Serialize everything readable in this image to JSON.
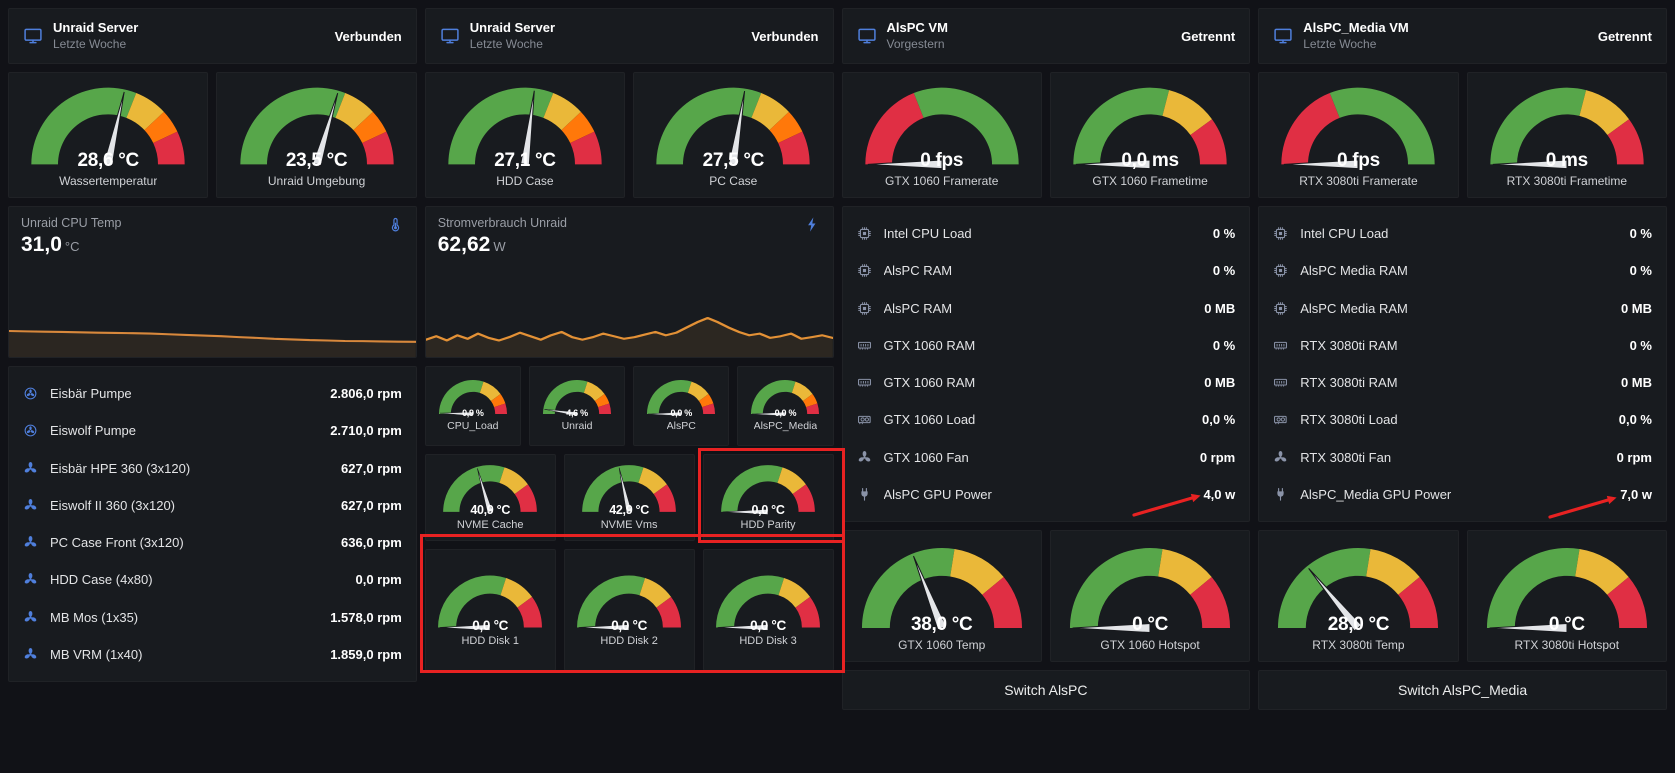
{
  "colors": {
    "green": "#57a64a",
    "yellow": "#eab839",
    "orange": "#ff780a",
    "red": "#e02f44",
    "needle": "#e3e5e8",
    "icon_blue": "#4f7fdc",
    "icon_muted": "#8a93a8",
    "annotation": "#e82222",
    "panel_bg": "#181b1f",
    "page_bg": "#111217"
  },
  "gauge_presets": {
    "temp": [
      [
        0,
        0.62,
        "green"
      ],
      [
        0.62,
        0.76,
        "yellow"
      ],
      [
        0.76,
        0.86,
        "orange"
      ],
      [
        0.86,
        1,
        "red"
      ]
    ],
    "fps": [
      [
        0,
        0.38,
        "red"
      ],
      [
        0.38,
        1,
        "green"
      ]
    ],
    "frametime": [
      [
        0,
        0.58,
        "green"
      ],
      [
        0.58,
        0.8,
        "yellow"
      ],
      [
        0.8,
        1,
        "red"
      ]
    ],
    "percent": [
      [
        0,
        0.6,
        "green"
      ],
      [
        0.6,
        0.8,
        "yellow"
      ],
      [
        0.8,
        0.9,
        "orange"
      ],
      [
        0.9,
        1,
        "red"
      ]
    ],
    "disk": [
      [
        0,
        0.6,
        "green"
      ],
      [
        0.6,
        0.8,
        "yellow"
      ],
      [
        0.8,
        1,
        "red"
      ]
    ],
    "gpu": [
      [
        0,
        0.55,
        "green"
      ],
      [
        0.55,
        0.78,
        "yellow"
      ],
      [
        0.78,
        1,
        "red"
      ]
    ]
  },
  "headers": [
    {
      "icon": "monitor-icon",
      "title": "Unraid Server",
      "subtitle": "Letzte Woche",
      "status": "Verbunden"
    },
    {
      "icon": "monitor-icon",
      "title": "Unraid Server",
      "subtitle": "Letzte Woche",
      "status": "Verbunden"
    },
    {
      "icon": "monitor-icon",
      "title": "AlsPC VM",
      "subtitle": "Vorgestern",
      "status": "Getrennt"
    },
    {
      "icon": "monitor-icon",
      "title": "AlsPC_Media VM",
      "subtitle": "Letzte Woche",
      "status": "Getrennt"
    }
  ],
  "gauges": {
    "wasser": {
      "value": "28,6 °C",
      "label": "Wassertemperatur",
      "pct": 0.57,
      "preset": "temp"
    },
    "umgebung": {
      "value": "23,5 °C",
      "label": "Unraid Umgebung",
      "pct": 0.59,
      "preset": "temp"
    },
    "hdd_case": {
      "value": "27,1 °C",
      "label": "HDD Case",
      "pct": 0.54,
      "preset": "temp"
    },
    "pc_case": {
      "value": "27,5 °C",
      "label": "PC Case",
      "pct": 0.55,
      "preset": "temp"
    },
    "gtx_fps": {
      "value": "0 fps",
      "label": "GTX 1060 Framerate",
      "pct": 0,
      "preset": "fps"
    },
    "gtx_ft": {
      "value": "0,0 ms",
      "label": "GTX 1060 Frametime",
      "pct": 0,
      "preset": "frametime"
    },
    "rtx_fps": {
      "value": "0 fps",
      "label": "RTX 3080ti Framerate",
      "pct": 0,
      "preset": "fps"
    },
    "rtx_ft": {
      "value": "0 ms",
      "label": "RTX 3080ti Frametime",
      "pct": 0,
      "preset": "frametime"
    },
    "cpu_load": {
      "value": "0,9 %",
      "label": "CPU_Load",
      "pct": 0.009,
      "preset": "percent"
    },
    "unraid": {
      "value": "4,6 %",
      "label": "Unraid",
      "pct": 0.046,
      "preset": "percent"
    },
    "alspc": {
      "value": "0,0 %",
      "label": "AlsPC",
      "pct": 0,
      "preset": "percent"
    },
    "alspc_media": {
      "value": "0,0 %",
      "label": "AlsPC_Media",
      "pct": 0,
      "preset": "percent"
    },
    "nvme_cache": {
      "value": "40,9 °C",
      "label": "NVME Cache",
      "pct": 0.41,
      "preset": "disk"
    },
    "nvme_vms": {
      "value": "42,9 °C",
      "label": "NVME Vms",
      "pct": 0.43,
      "preset": "disk"
    },
    "hdd_parity": {
      "value": "0,0 °C",
      "label": "HDD Parity",
      "pct": 0,
      "preset": "disk"
    },
    "hdd1": {
      "value": "0,0 °C",
      "label": "HDD Disk 1",
      "pct": 0,
      "preset": "disk"
    },
    "hdd2": {
      "value": "0,0 °C",
      "label": "HDD Disk 2",
      "pct": 0,
      "preset": "disk"
    },
    "hdd3": {
      "value": "0,0 °C",
      "label": "HDD Disk 3",
      "pct": 0,
      "preset": "disk"
    },
    "gtx_temp": {
      "value": "38,0 °C",
      "label": "GTX 1060 Temp",
      "pct": 0.38,
      "preset": "gpu"
    },
    "gtx_hot": {
      "value": "0 °C",
      "label": "GTX 1060 Hotspot",
      "pct": 0,
      "preset": "gpu"
    },
    "rtx_temp": {
      "value": "28,0 °C",
      "label": "RTX 3080ti Temp",
      "pct": 0.28,
      "preset": "gpu"
    },
    "rtx_hot": {
      "value": "0 °C",
      "label": "RTX 3080ti Hotspot",
      "pct": 0,
      "preset": "gpu"
    }
  },
  "charts": {
    "cpu": {
      "type": "line",
      "icon": "thermometer-icon",
      "title": "Unraid CPU Temp",
      "value": "31,0",
      "unit": "°C",
      "color": "#d8883c",
      "fill": "rgba(216,136,60,0.10)",
      "ylim": [
        26,
        38
      ],
      "values": [
        32.0,
        31.9,
        31.85,
        31.8,
        31.7,
        31.6,
        31.55,
        31.5,
        31.4,
        31.25,
        31.1,
        30.95,
        30.8,
        30.6,
        30.4,
        30.2,
        30.05,
        29.9,
        29.8,
        29.7,
        29.65,
        29.6,
        29.55,
        29.5
      ]
    },
    "strom": {
      "type": "line",
      "icon": "bolt-icon",
      "title": "Stromverbrauch Unraid",
      "value": "62,62",
      "unit": "W",
      "color": "#e39136",
      "fill": "rgba(227,145,54,0.10)",
      "ylim": [
        52,
        82
      ],
      "values": [
        62,
        64,
        61.5,
        64.5,
        62.5,
        65.5,
        63,
        61.5,
        63.5,
        66,
        64,
        62,
        64.5,
        66.5,
        63.5,
        62,
        63.5,
        65.5,
        64,
        62.5,
        63.5,
        65,
        66.5,
        64.5,
        66,
        69,
        72,
        74.5,
        72,
        69,
        66.5,
        64.5,
        65.5,
        63,
        64,
        65.5,
        62.5,
        63.5,
        64.5,
        63
      ]
    }
  },
  "fan_list": {
    "rows": [
      {
        "icon": "pump-icon",
        "label": "Eisbär Pumpe",
        "value": "2.806,0 rpm"
      },
      {
        "icon": "pump-icon",
        "label": "Eiswolf Pumpe",
        "value": "2.710,0 rpm"
      },
      {
        "icon": "fan-icon",
        "label": "Eisbär HPE 360 (3x120)",
        "value": "627,0 rpm"
      },
      {
        "icon": "fan-icon",
        "label": "Eiswolf II 360 (3x120)",
        "value": "627,0 rpm"
      },
      {
        "icon": "fan-icon",
        "label": "PC Case Front (3x120)",
        "value": "636,0 rpm"
      },
      {
        "icon": "fan-icon",
        "label": "HDD Case (4x80)",
        "value": "0,0 rpm"
      },
      {
        "icon": "fan-icon",
        "label": "MB Mos (1x35)",
        "value": "1.578,0 rpm"
      },
      {
        "icon": "fan-icon",
        "label": "MB VRM (1x40)",
        "value": "1.859,0 rpm"
      }
    ]
  },
  "stats_alspc": {
    "rows": [
      {
        "icon": "cpu-icon",
        "label": "Intel CPU Load",
        "value": "0 %"
      },
      {
        "icon": "ram-icon",
        "label": "AlsPC RAM",
        "value": "0 %"
      },
      {
        "icon": "ram-icon",
        "label": "AlsPC RAM",
        "value": "0 MB"
      },
      {
        "icon": "gpu-ram-icon",
        "label": "GTX 1060 RAM",
        "value": "0 %"
      },
      {
        "icon": "gpu-ram-icon",
        "label": "GTX 1060 RAM",
        "value": "0 MB"
      },
      {
        "icon": "gpu-icon",
        "label": "GTX 1060 Load",
        "value": "0,0 %"
      },
      {
        "icon": "fan-icon",
        "label": "GTX 1060 Fan",
        "value": "0 rpm"
      },
      {
        "icon": "power-icon",
        "label": "AlsPC GPU Power",
        "value": "4,0 w"
      }
    ]
  },
  "stats_media": {
    "rows": [
      {
        "icon": "cpu-icon",
        "label": "Intel CPU Load",
        "value": "0 %"
      },
      {
        "icon": "ram-icon",
        "label": "AlsPC Media RAM",
        "value": "0 %"
      },
      {
        "icon": "ram-icon",
        "label": "AlsPC Media RAM",
        "value": "0 MB"
      },
      {
        "icon": "gpu-ram-icon",
        "label": "RTX 3080ti RAM",
        "value": "0 %"
      },
      {
        "icon": "gpu-ram-icon",
        "label": "RTX 3080ti RAM",
        "value": "0 MB"
      },
      {
        "icon": "gpu-icon",
        "label": "RTX 3080ti Load",
        "value": "0,0 %"
      },
      {
        "icon": "fan-icon",
        "label": "RTX 3080ti Fan",
        "value": "0 rpm"
      },
      {
        "icon": "power-icon",
        "label": "AlsPC_Media GPU Power",
        "value": "7,0 w"
      }
    ]
  },
  "buttons": {
    "switch_alspc": "Switch AlsPC",
    "switch_media": "Switch AlsPC_Media"
  }
}
